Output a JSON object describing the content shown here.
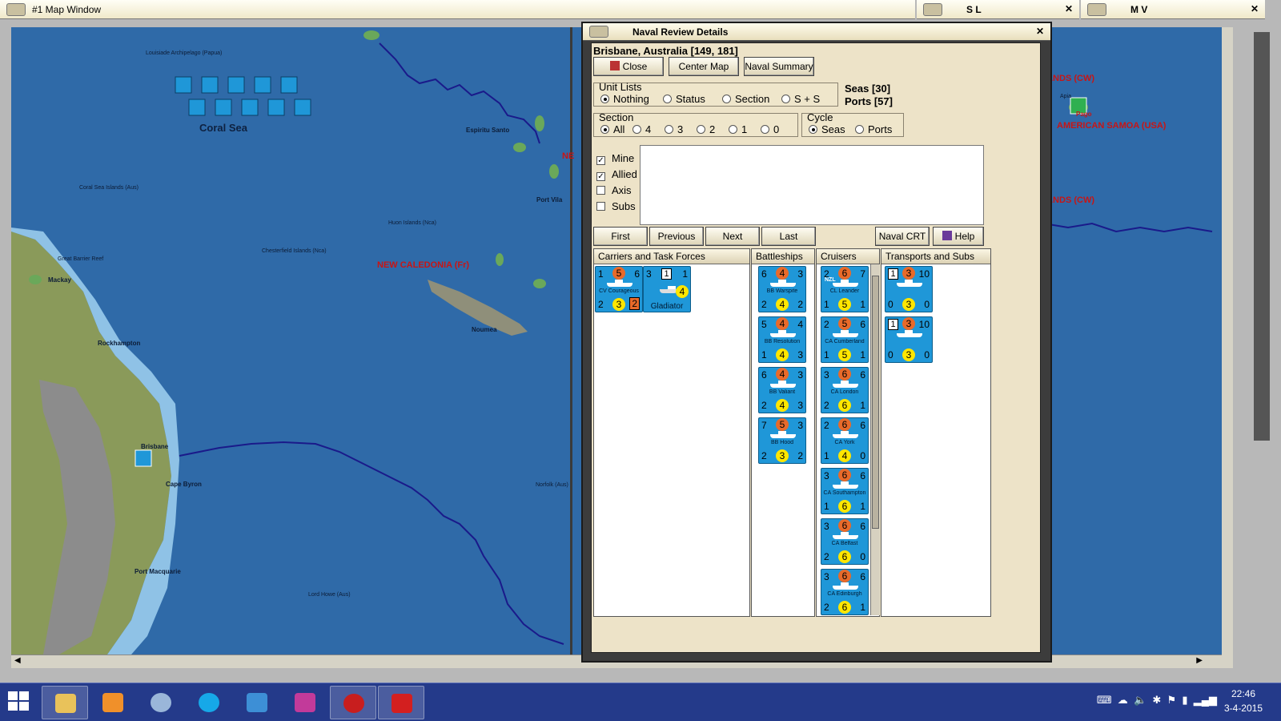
{
  "map_window": {
    "title": "#1 Map Window",
    "side_panels": [
      {
        "label": "S L"
      },
      {
        "label": "M V"
      }
    ],
    "labels": {
      "coral_sea": "Coral Sea",
      "new_caledonia": "NEW CALEDONIA (Fr)",
      "american_samoa": "AMERICAN SAMOA (USA)",
      "islands_cw_1": "ISLANDS (CW)",
      "islands_cw_2": "ISLANDS (CW)",
      "ne": "NE",
      "rockhampton": "Rockhampton",
      "mackay": "Mackay",
      "brisbane": "Brisbane",
      "cape_byron": "Cape Byron",
      "port_macquarie": "Port Macquarie",
      "noumea": "Noumea",
      "port_vila": "Port Vila",
      "espiritu_santo": "Espiritu Santo",
      "coral_sea_islands": "Coral Sea Islands (Aus)",
      "chesterfield": "Chesterfield Islands (Nca)",
      "huon": "Huon Islands (Nca)",
      "lord_howe": "Lord Howe (Aus)",
      "norfolk": "Norfolk (Aus)",
      "louisiade": "Louisiade Archipelago (Papua)",
      "great_barrier_reef": "Great Barrier Reef",
      "apia": "Apia",
      "pago": "Pago"
    }
  },
  "dialog": {
    "title": "Naval Review Details",
    "location": "Brisbane, Australia [149, 181]",
    "buttons": {
      "close": "Close",
      "center_map": "Center Map",
      "naval_summary": "Naval Summary",
      "first": "First",
      "previous": "Previous",
      "next": "Next",
      "last": "Last",
      "naval_crt": "Naval CRT",
      "help": "Help"
    },
    "unit_lists": {
      "title": "Unit Lists",
      "options": [
        "Nothing",
        "Status",
        "Section",
        "S + S"
      ],
      "selected": "Nothing"
    },
    "seas": "Seas [30]",
    "ports": "Ports [57]",
    "section": {
      "title": "Section",
      "options": [
        "All",
        "4",
        "3",
        "2",
        "1",
        "0"
      ],
      "selected": "All"
    },
    "cycle": {
      "title": "Cycle",
      "options": [
        "Seas",
        "Ports"
      ],
      "selected": "Seas"
    },
    "filters": [
      {
        "label": "Mine",
        "checked": true
      },
      {
        "label": "Allied",
        "checked": true
      },
      {
        "label": "Axis",
        "checked": false
      },
      {
        "label": "Subs",
        "checked": false
      }
    ],
    "columns": {
      "carriers": "Carriers and Task Forces",
      "battleships": "Battleships",
      "cruisers": "Cruisers",
      "transports": "Transports and Subs"
    },
    "carriers": [
      {
        "tl": "1",
        "mid": "5",
        "tr": "6",
        "bl": "2",
        "bot": "3",
        "br": "2",
        "name": "CV Courageous"
      },
      {
        "tl": "3",
        "mid": "1",
        "tr": "1",
        "bl": "",
        "bot": "4",
        "br": "",
        "name": "Gladiator"
      }
    ],
    "battleships": [
      {
        "tl": "6",
        "mid": "4",
        "tr": "3",
        "bl": "2",
        "bot": "4",
        "br": "2",
        "name": "BB Warspite"
      },
      {
        "tl": "5",
        "mid": "4",
        "tr": "4",
        "bl": "1",
        "bot": "4",
        "br": "3",
        "name": "BB Resolution"
      },
      {
        "tl": "6",
        "mid": "4",
        "tr": "3",
        "bl": "2",
        "bot": "4",
        "br": "3",
        "name": "BB Valiant"
      },
      {
        "tl": "7",
        "mid": "5",
        "tr": "3",
        "bl": "2",
        "bot": "3",
        "br": "2",
        "name": "BB Hood"
      }
    ],
    "cruisers": [
      {
        "tl": "2",
        "mid": "6",
        "tr": "7",
        "bl": "1",
        "bot": "5",
        "br": "1",
        "name": "CL Leander",
        "tag": "NZL"
      },
      {
        "tl": "2",
        "mid": "5",
        "tr": "6",
        "bl": "1",
        "bot": "5",
        "br": "1",
        "name": "CA Cumberland"
      },
      {
        "tl": "3",
        "mid": "6",
        "tr": "6",
        "bl": "2",
        "bot": "6",
        "br": "1",
        "name": "CA London"
      },
      {
        "tl": "2",
        "mid": "6",
        "tr": "6",
        "bl": "1",
        "bot": "4",
        "br": "0",
        "name": "CA York"
      },
      {
        "tl": "3",
        "mid": "6",
        "tr": "6",
        "bl": "1",
        "bot": "6",
        "br": "1",
        "name": "CA Southampton"
      },
      {
        "tl": "3",
        "mid": "6",
        "tr": "6",
        "bl": "2",
        "bot": "6",
        "br": "0",
        "name": "CA Belfast"
      },
      {
        "tl": "3",
        "mid": "6",
        "tr": "6",
        "bl": "2",
        "bot": "6",
        "br": "1",
        "name": "CA Edinburgh"
      }
    ],
    "transports": [
      {
        "sq": "1",
        "mid": "3",
        "tr": "10",
        "bl": "0",
        "bot": "3",
        "br": "0"
      },
      {
        "sq": "1",
        "mid": "3",
        "tr": "10",
        "bl": "0",
        "bot": "3",
        "br": "0"
      }
    ]
  },
  "taskbar": {
    "apps": [
      "file-explorer",
      "media-player",
      "thunderbird",
      "skype",
      "browser",
      "game-fire",
      "world-in-flames",
      "pdf-reader"
    ],
    "clock_time": "22:46",
    "clock_date": "3-4-2015"
  },
  "colors": {
    "sea": "#2f6aa8",
    "unit_blue": "#1f97d8",
    "attack_orange": "#e86a2a",
    "defense_yellow": "#ffe600",
    "dialog_bg": "#ede3c8",
    "taskbar": "#243a8a"
  }
}
